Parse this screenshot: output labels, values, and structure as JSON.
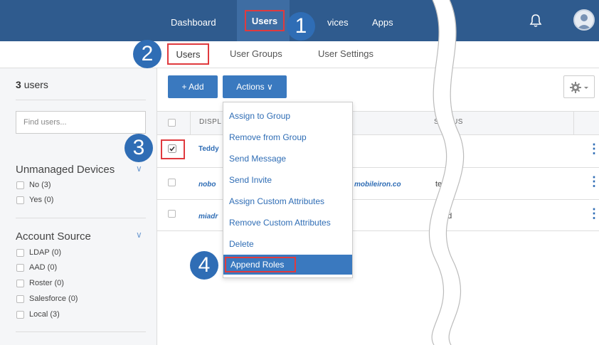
{
  "topnav": {
    "dashboard": "Dashboard",
    "users": "Users",
    "devices": "vices",
    "apps": "Apps"
  },
  "subnav": {
    "users": "Users",
    "user_groups": "User Groups",
    "user_settings": "User Settings"
  },
  "sidebar": {
    "users_count_num": "3",
    "users_count_label": "users",
    "search_placeholder": "Find users...",
    "unmanaged": {
      "title": "Unmanaged Devices",
      "options": [
        "No  (3)",
        "Yes  (0)"
      ]
    },
    "account_source": {
      "title": "Account Source",
      "options": [
        "LDAP  (0)",
        "AAD  (0)",
        "Roster  (0)",
        "Salesforce  (0)",
        "Local  (3)"
      ]
    }
  },
  "toolbar": {
    "add": "+ Add",
    "actions": "Actions ∨"
  },
  "table": {
    "headers": {
      "display": "DISPL",
      "status": "STATUS"
    },
    "rows": [
      {
        "name": "Teddy",
        "email": "",
        "status": ""
      },
      {
        "name": "nobo",
        "email": "mobileiron.co",
        "status": "ted"
      },
      {
        "name": "miadr",
        "email": "",
        "status": "vited"
      }
    ]
  },
  "actions_menu": [
    "Assign to Group",
    "Remove from Group",
    "Send Message",
    "Send Invite",
    "Assign Custom Attributes",
    "Remove Custom Attributes",
    "Delete",
    "Append Roles"
  ],
  "callouts": [
    "1",
    "2",
    "3",
    "4"
  ],
  "colors": {
    "topbar": "#2f5b8e",
    "accent": "#3a79bf",
    "highlight_box": "#e03a3e"
  }
}
